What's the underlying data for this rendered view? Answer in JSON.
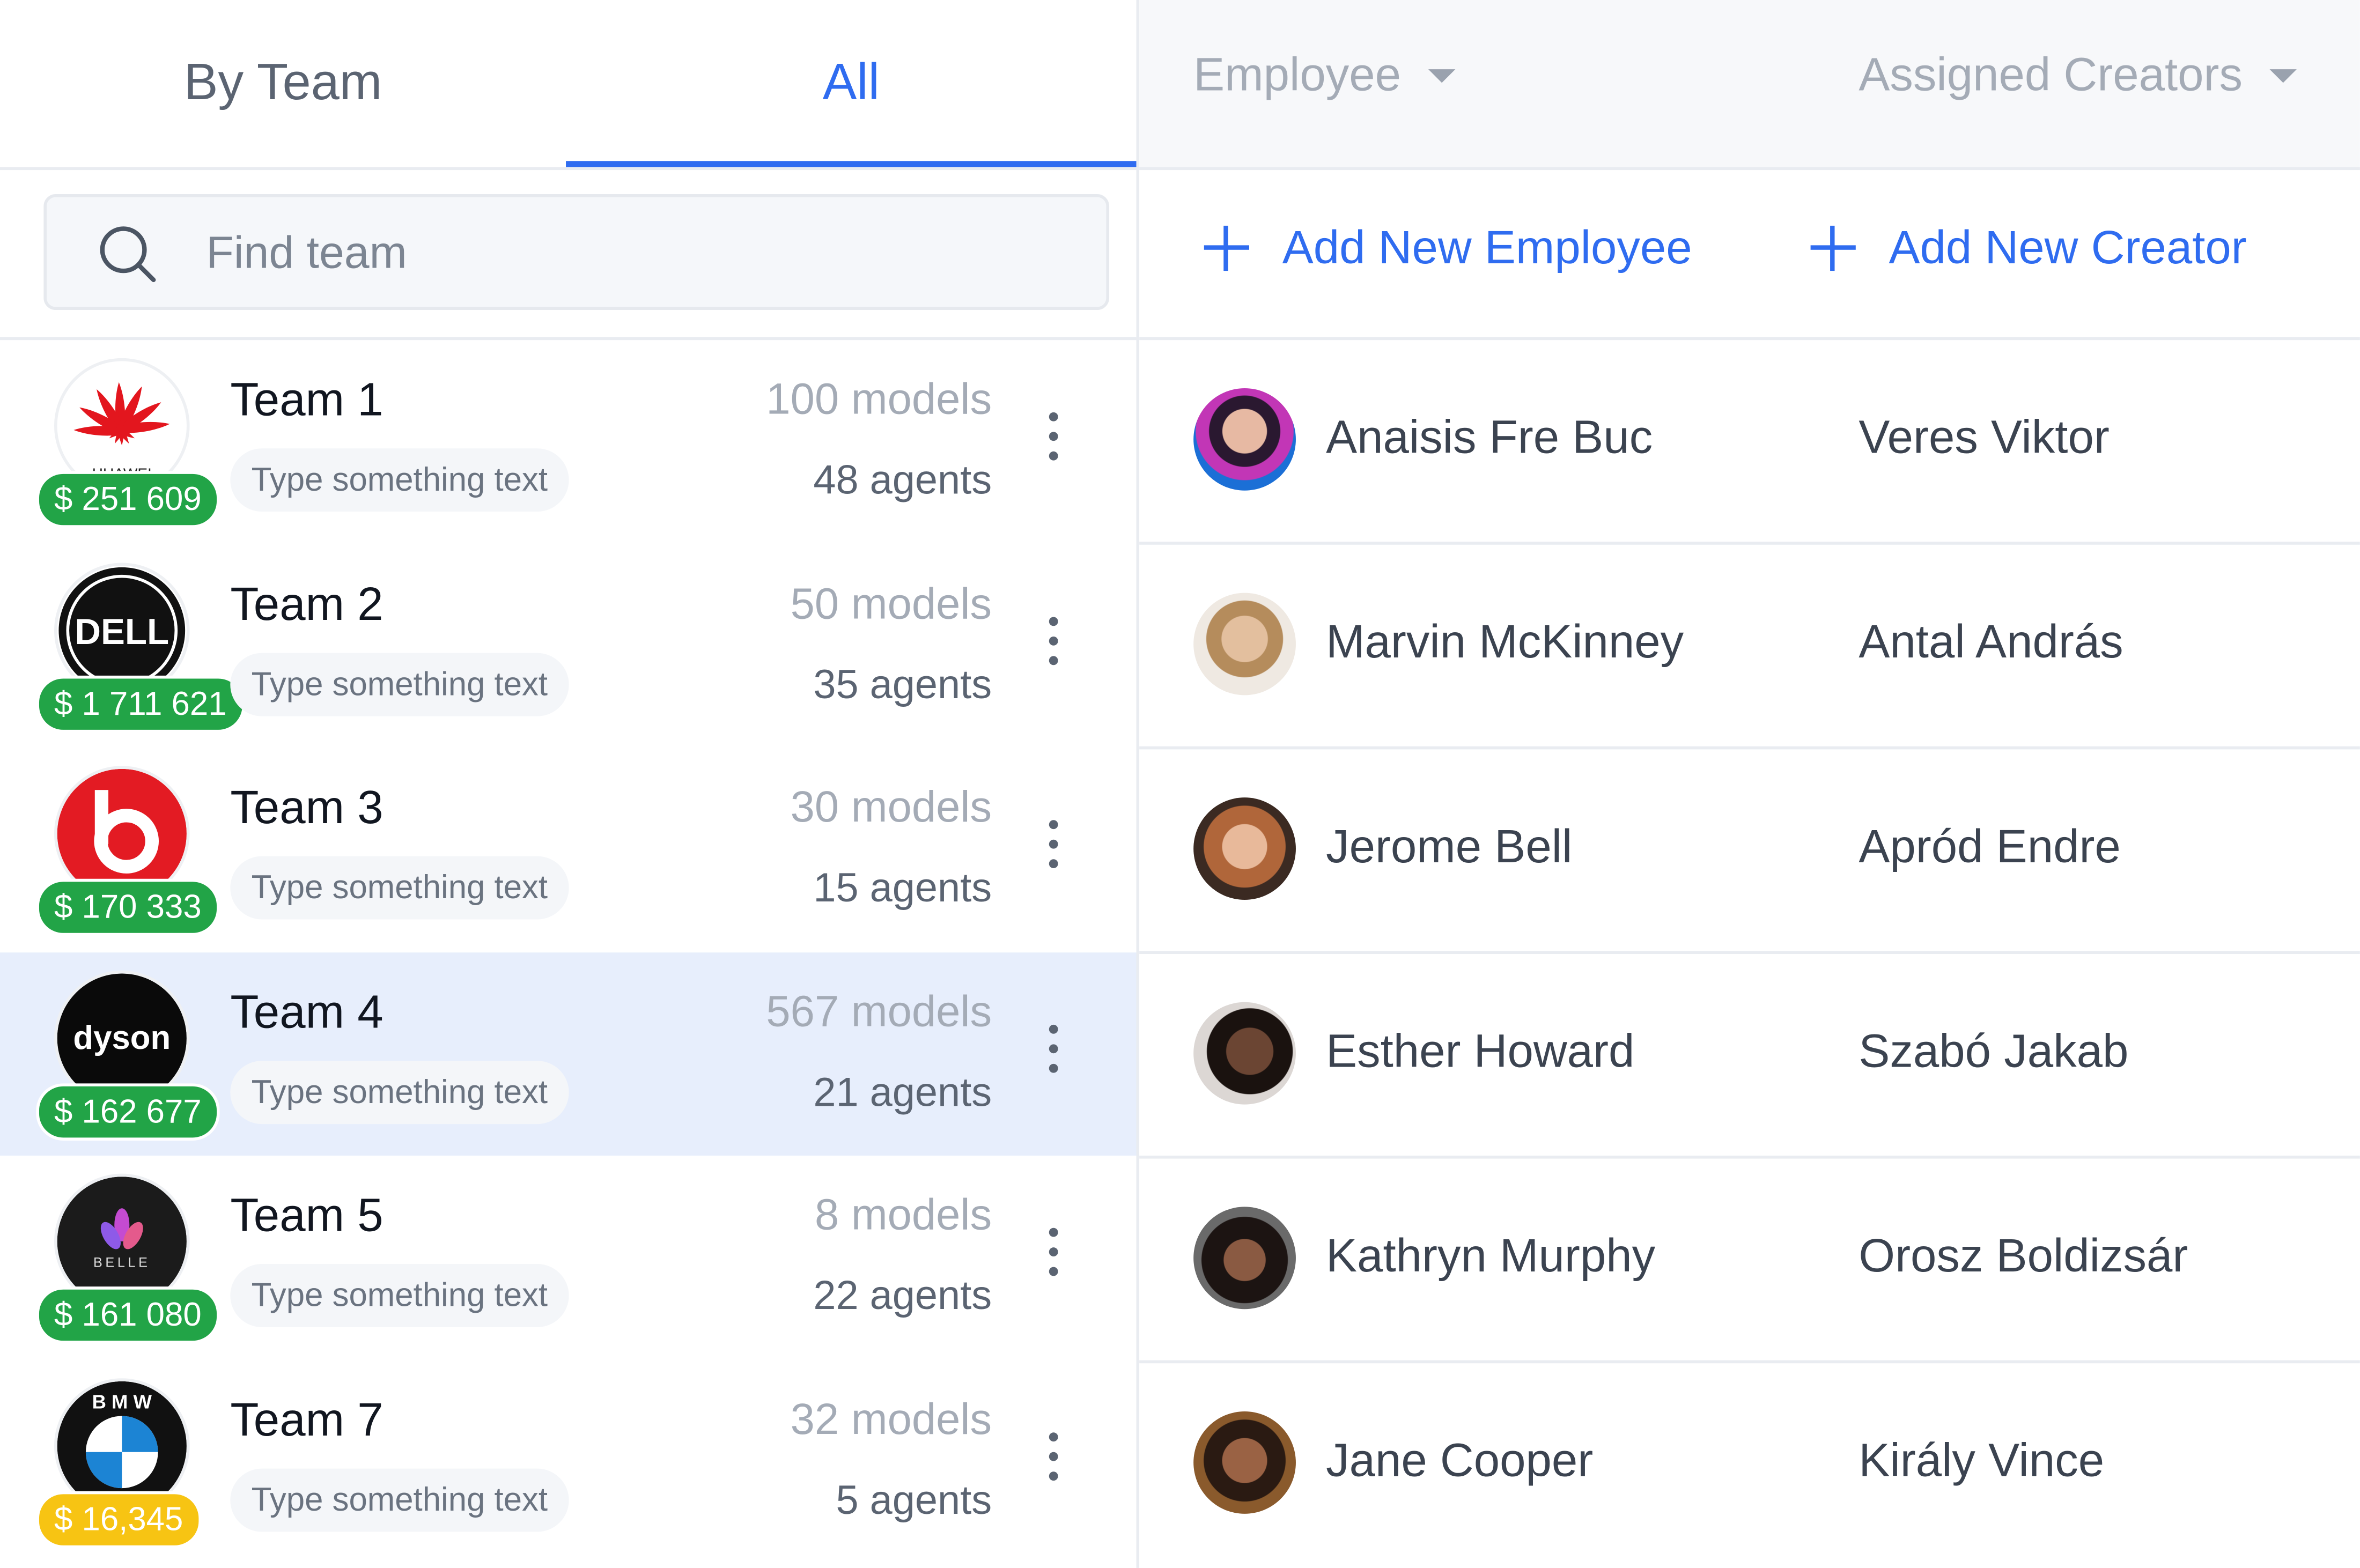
{
  "tabs": {
    "by_team": "By Team",
    "all": "All"
  },
  "search": {
    "placeholder": "Find team"
  },
  "teams": [
    {
      "name": "Team 1",
      "tag": "Type something text",
      "models": "100 models",
      "agents": "48 agents",
      "amount": "$ 251 609",
      "logo": "huawei-logo",
      "logo_text": "HUAWEI"
    },
    {
      "name": "Team 2",
      "tag": "Type something text",
      "models": "50 models",
      "agents": "35 agents",
      "amount": "$ 1 711 621",
      "logo": "dell-logo",
      "logo_text": "DELL"
    },
    {
      "name": "Team 3",
      "tag": "Type something text",
      "models": "30 models",
      "agents": "15 agents",
      "amount": "$ 170 333",
      "logo": "beats-logo",
      "logo_text": "b"
    },
    {
      "name": "Team 4",
      "tag": "Type something text",
      "models": "567 models",
      "agents": "21 agents",
      "amount": "$ 162 677",
      "logo": "dyson-logo",
      "logo_text": "dyson"
    },
    {
      "name": "Team 5",
      "tag": "Type something text",
      "models": "8 models",
      "agents": "22 agents",
      "amount": "$ 161 080",
      "logo": "belle-logo",
      "logo_text": "BELLE"
    },
    {
      "name": "Team 7",
      "tag": "Type something text",
      "models": "32 models",
      "agents": "5 agents",
      "amount": "$ 16,345",
      "logo": "bmw-logo",
      "logo_text": "BMW"
    }
  ],
  "header": {
    "employee": "Employee",
    "assigned_creators": "Assigned Creators"
  },
  "actions": {
    "add_employee": "Add New Employee",
    "add_creator": "Add New Creator"
  },
  "people": [
    {
      "employee": "Anaisis Fre Buc",
      "creator": "Veres Viktor"
    },
    {
      "employee": "Marvin McKinney",
      "creator": "Antal András"
    },
    {
      "employee": "Jerome Bell",
      "creator": "Apród Endre"
    },
    {
      "employee": "Esther Howard",
      "creator": "Szabó Jakab"
    },
    {
      "employee": "Kathryn Murphy",
      "creator": "Orosz Boldizsár"
    },
    {
      "employee": "Jane Cooper",
      "creator": "Király Vince"
    }
  ],
  "colors": {
    "accent": "#2f6cf0",
    "badge_green": "#22a447",
    "badge_yellow": "#f7c413",
    "selected_row": "#e7eefc"
  }
}
